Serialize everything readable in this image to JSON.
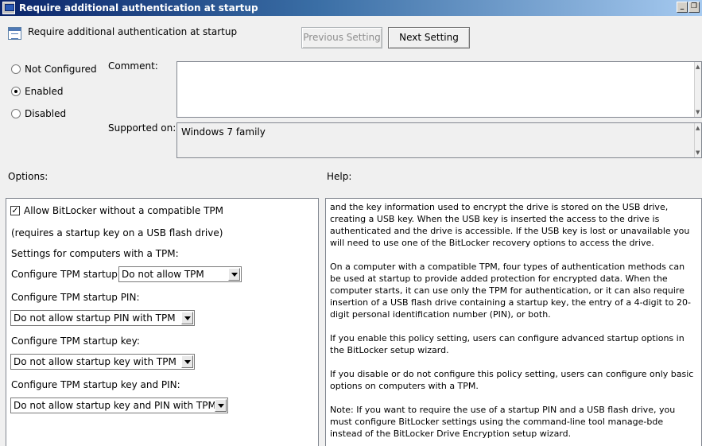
{
  "window": {
    "title": "Require additional authentication at startup",
    "minimize_glyph": "_",
    "restore_glyph": "❐"
  },
  "header": {
    "policy_name": "Require additional authentication at startup",
    "previous_button": "Previous Setting",
    "next_button": "Next Setting"
  },
  "state": {
    "options": [
      {
        "label": "Not Configured",
        "selected": false
      },
      {
        "label": "Enabled",
        "selected": true
      },
      {
        "label": "Disabled",
        "selected": false
      }
    ]
  },
  "comment": {
    "label": "Comment:",
    "value": ""
  },
  "supported": {
    "label": "Supported on:",
    "value": "Windows 7 family"
  },
  "options_pane": {
    "label": "Options:",
    "allow_bitlocker": {
      "label": "Allow BitLocker without a compatible TPM",
      "checked": true
    },
    "requires_note": "(requires a startup key on a USB flash drive)",
    "tpm_settings_heading": "Settings for computers with a TPM:",
    "tpm_startup": {
      "label": "Configure TPM startup:",
      "value": "Do not allow TPM"
    },
    "tpm_pin": {
      "label": "Configure TPM startup PIN:",
      "value": "Do not allow startup PIN with TPM"
    },
    "tpm_key": {
      "label": "Configure TPM startup key:",
      "value": "Do not allow startup key with TPM"
    },
    "tpm_key_pin": {
      "label": "Configure TPM startup key and PIN:",
      "value": "Do not allow startup key and PIN with TPM"
    }
  },
  "help_pane": {
    "label": "Help:",
    "paragraphs": [
      "and the key information used to encrypt the drive is stored on the USB drive, creating a USB key. When the USB key is inserted the access to the drive is authenticated and the drive is accessible. If the USB key is lost or unavailable you will need to use one of the BitLocker recovery options to access the drive.",
      "On a computer with a compatible TPM, four types of authentication methods can be used at startup to provide added protection for encrypted data. When the computer starts, it can use only the TPM for authentication, or it can also require insertion of a USB flash drive containing a startup key, the entry of a 4-digit to 20-digit personal identification number (PIN), or both.",
      "If you enable this policy setting, users can configure advanced startup options in the BitLocker setup wizard.",
      "If you disable or do not configure this policy setting, users can configure only basic options on computers with a TPM.",
      "Note: If you want to require the use of a startup PIN and a USB flash drive, you must configure BitLocker settings using the command-line tool manage-bde instead of the BitLocker Drive Encryption setup wizard."
    ]
  }
}
